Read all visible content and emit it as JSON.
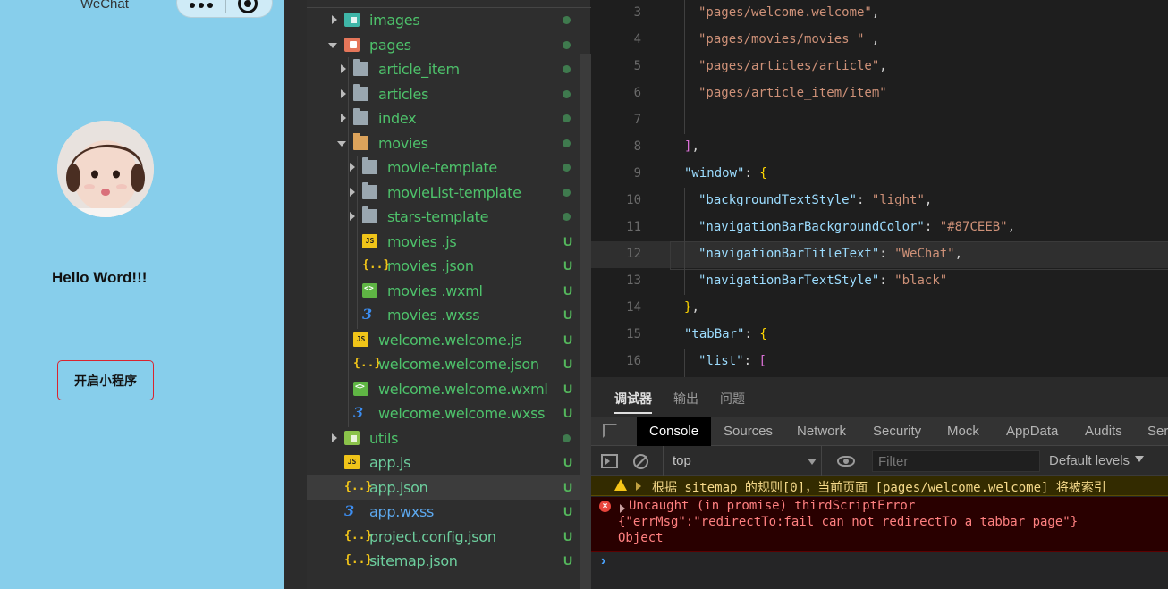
{
  "simulator": {
    "nav_title": "WeChat",
    "background_color": "#87CEEB",
    "hello_text": "Hello Word!!!",
    "button_label": "开启小程序"
  },
  "file_tree": {
    "items": [
      {
        "label": "images",
        "icon": "images-folder-icon",
        "status": "dot"
      },
      {
        "label": "pages",
        "icon": "pages-folder-icon",
        "status": "dot"
      },
      {
        "label": "article_item",
        "icon": "folder-icon",
        "status": "dot"
      },
      {
        "label": "articles",
        "icon": "folder-icon",
        "status": "dot"
      },
      {
        "label": "index",
        "icon": "folder-icon",
        "status": "dot"
      },
      {
        "label": "movies",
        "icon": "folder-open-icon",
        "status": "dot"
      },
      {
        "label": "movie-template",
        "icon": "folder-icon",
        "status": "dot"
      },
      {
        "label": "movieList-template",
        "icon": "folder-icon",
        "status": "dot"
      },
      {
        "label": "stars-template",
        "icon": "folder-icon",
        "status": "dot"
      },
      {
        "label": "movies .js",
        "icon": "js-file-icon",
        "status": "U"
      },
      {
        "label": "movies .json",
        "icon": "json-file-icon",
        "status": "U"
      },
      {
        "label": "movies .wxml",
        "icon": "wxml-file-icon",
        "status": "U"
      },
      {
        "label": "movies .wxss",
        "icon": "wxss-file-icon",
        "status": "U"
      },
      {
        "label": "welcome.welcome.js",
        "icon": "js-file-icon",
        "status": "U"
      },
      {
        "label": "welcome.welcome.json",
        "icon": "json-file-icon",
        "status": "U"
      },
      {
        "label": "welcome.welcome.wxml",
        "icon": "wxml-file-icon",
        "status": "U"
      },
      {
        "label": "welcome.welcome.wxss",
        "icon": "wxss-file-icon",
        "status": "U"
      },
      {
        "label": "utils",
        "icon": "utils-folder-icon",
        "status": "dot"
      },
      {
        "label": "app.js",
        "icon": "js-file-icon",
        "status": "U"
      },
      {
        "label": "app.json",
        "icon": "json-file-icon",
        "status": "U"
      },
      {
        "label": "app.wxss",
        "icon": "wxss-file-icon",
        "status": "U"
      },
      {
        "label": "project.config.json",
        "icon": "json-file-icon",
        "status": "U"
      },
      {
        "label": "sitemap.json",
        "icon": "json-file-icon",
        "status": "U"
      }
    ],
    "status_untracked": "U"
  },
  "editor": {
    "lines": [
      {
        "num": "3",
        "text": "\"pages/welcome.welcome\","
      },
      {
        "num": "4",
        "text": "\"pages/movies/movies \" ,"
      },
      {
        "num": "5",
        "text": "\"pages/articles/article\","
      },
      {
        "num": "6",
        "text": "\"pages/article_item/item\""
      },
      {
        "num": "7",
        "text": ""
      },
      {
        "num": "8",
        "text": "],"
      },
      {
        "num": "9",
        "text": "\"window\": {"
      },
      {
        "num": "10",
        "text": "\"backgroundTextStyle\": \"light\","
      },
      {
        "num": "11",
        "text": "\"navigationBarBackgroundColor\": \"#87CEEB\","
      },
      {
        "num": "12",
        "text": "\"navigationBarTitleText\": \"WeChat\","
      },
      {
        "num": "13",
        "text": "\"navigationBarTextStyle\": \"black\""
      },
      {
        "num": "14",
        "text": "},"
      },
      {
        "num": "15",
        "text": "\"tabBar\": {"
      },
      {
        "num": "16",
        "text": "\"list\": ["
      }
    ]
  },
  "debug_panel": {
    "tabs": [
      "调试器",
      "输出",
      "问题"
    ],
    "devtools_tabs": [
      "Console",
      "Sources",
      "Network",
      "Security",
      "Mock",
      "AppData",
      "Audits",
      "Ser"
    ],
    "context": "top",
    "filter_placeholder": "Filter",
    "levels": "Default levels",
    "warning": "根据 sitemap 的规则[0]，当前页面 [pages/welcome.welcome] 将被索引",
    "error_lines": [
      "Uncaught (in promise) thirdScriptError",
      "{\"errMsg\":\"redirectTo:fail can not redirectTo a tabbar page\"}",
      "Object"
    ],
    "prompt": "›"
  }
}
